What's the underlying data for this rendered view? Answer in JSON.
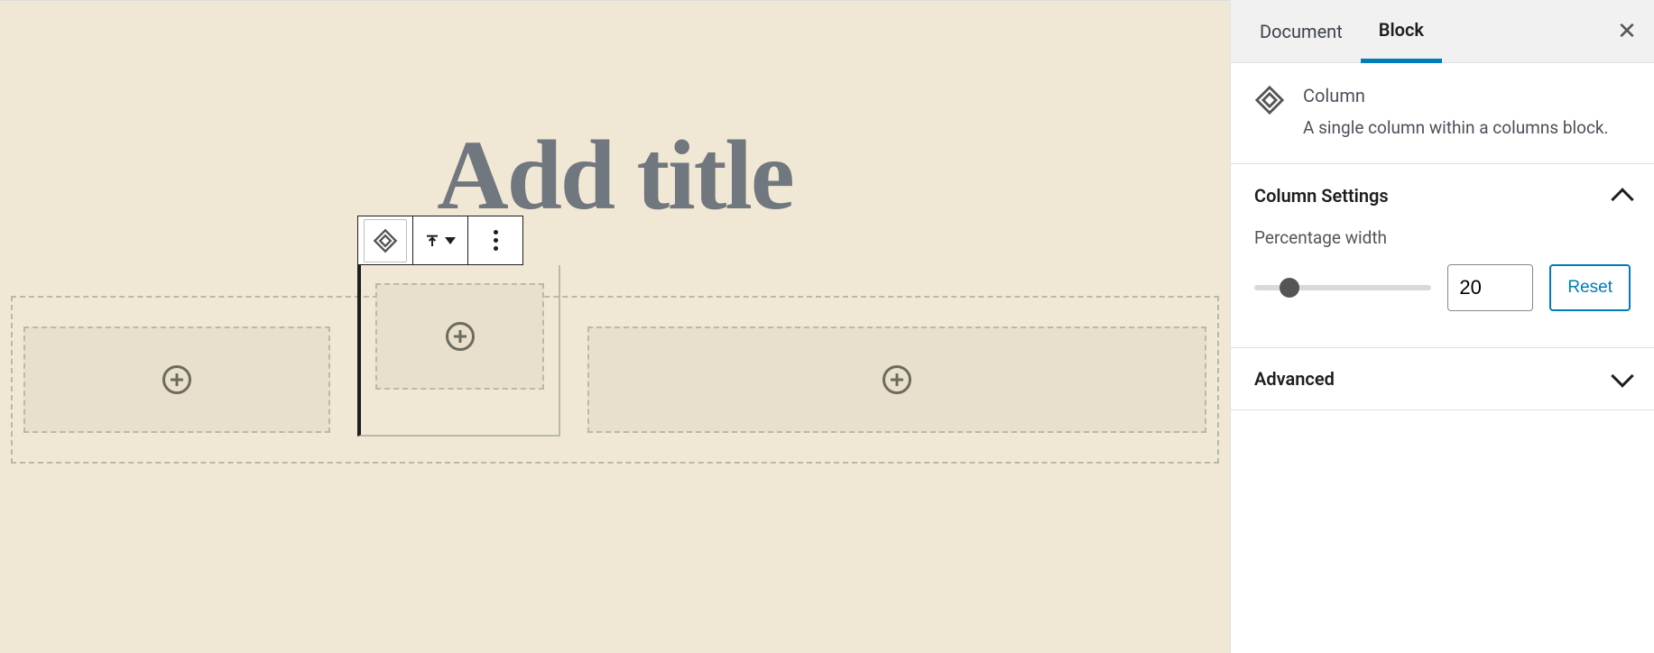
{
  "editor": {
    "title_placeholder": "Add title"
  },
  "sidebar": {
    "tabs": {
      "document": "Document",
      "block": "Block"
    },
    "block": {
      "name": "Column",
      "description": "A single column within a columns block."
    },
    "panels": {
      "column_settings": {
        "title": "Column Settings",
        "percentage_label": "Percentage width",
        "percentage_value": "20",
        "reset_label": "Reset"
      },
      "advanced": {
        "title": "Advanced"
      }
    }
  }
}
